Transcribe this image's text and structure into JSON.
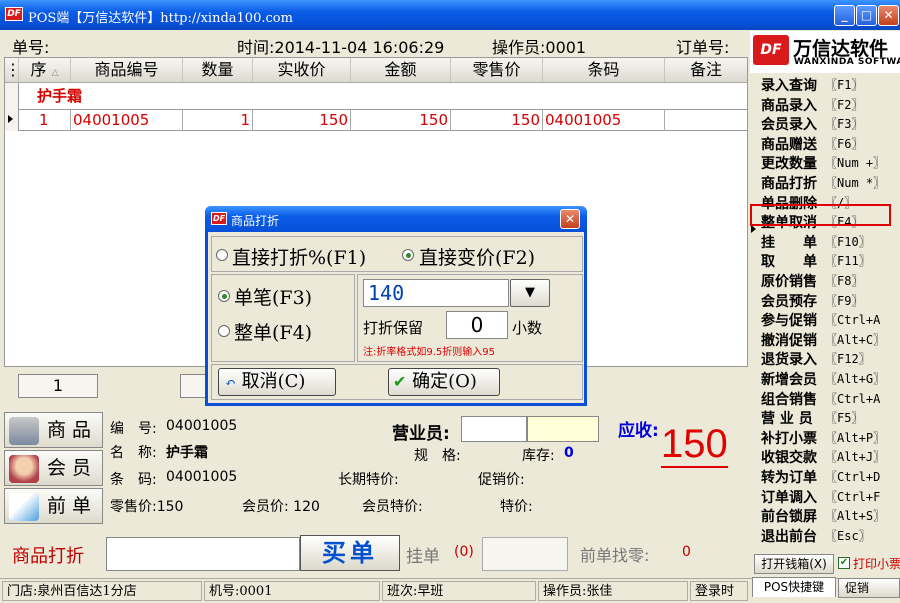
{
  "window": {
    "title": "POS端【万信达软件】http://xinda100.com",
    "min": "_",
    "max": "□",
    "close": "✕"
  },
  "info": {
    "order_no_label": "单号:",
    "time": "时间:2014-11-04 16:06:29",
    "operator": "操作员:0001",
    "order_label": "订单号:"
  },
  "grid": {
    "columns": [
      "序",
      "商品编号",
      "数量",
      "实收价",
      "金额",
      "零售价",
      "条码",
      "备注"
    ],
    "group_name": "护手霜",
    "rows": [
      {
        "seq": "1",
        "code": "04001005",
        "qty": "1",
        "paid": "150",
        "amount": "150",
        "retail": "150",
        "barcode": "04001005",
        "note": ""
      }
    ]
  },
  "pager": {
    "count": "1"
  },
  "nav": {
    "goods": "商品",
    "member": "会员",
    "prev": "前单"
  },
  "detail": {
    "code_label": "编　号:",
    "code": "04001005",
    "name_label": "名　称:",
    "name": "护手霜",
    "bar_label": "条　码:",
    "bar": "04001005",
    "retail": "零售价:150",
    "member_price": "会员价: 120",
    "member_special": "会员特价:",
    "special": "特价:",
    "long_special": "长期特价:",
    "promo": "促销价:",
    "spec": "规　格:",
    "stock_label": "库存:",
    "stock": "0",
    "salesman": "营业员:",
    "receivable": "应收:",
    "amount": "150"
  },
  "bottom": {
    "mode": "商品打折",
    "buy": "买单",
    "hang": "挂单",
    "hang_count": "(0)",
    "change": "前单找零:",
    "change_val": "0"
  },
  "status": {
    "store": "门店:泉州百信达1分店",
    "machine": "机号:0001",
    "shift": "班次:早班",
    "cashier": "操作员:张佳",
    "login": "登录时"
  },
  "brand": {
    "logo": "DF",
    "cn": "万信达软件",
    "en": "WANXINDA SOFTWARE"
  },
  "shortcuts": [
    {
      "name": "录入查询",
      "key": "〖F1〗"
    },
    {
      "name": "商品录入",
      "key": "〖F2〗"
    },
    {
      "name": "会员录入",
      "key": "〖F3〗"
    },
    {
      "name": "商品赠送",
      "key": "〖F6〗"
    },
    {
      "name": "更改数量",
      "key": "〖Num +〗"
    },
    {
      "name": "商品打折",
      "key": "〖Num *〗"
    },
    {
      "name": "单品删除",
      "key": "〖/〗"
    },
    {
      "name": "整单取消",
      "key": "〖F4〗"
    },
    {
      "name": "挂　　单",
      "key": "〖F10〗"
    },
    {
      "name": "取　　单",
      "key": "〖F11〗"
    },
    {
      "name": "原价销售",
      "key": "〖F8〗"
    },
    {
      "name": "会员预存",
      "key": "〖F9〗"
    },
    {
      "name": "参与促销",
      "key": "〖Ctrl+A"
    },
    {
      "name": "撤消促销",
      "key": "〖Alt+C〗"
    },
    {
      "name": "退货录入",
      "key": "〖F12〗"
    },
    {
      "name": "新增会员",
      "key": "〖Alt+G〗"
    },
    {
      "name": "组合销售",
      "key": "〖Ctrl+A"
    },
    {
      "name": "营 业 员",
      "key": "〖F5〗"
    },
    {
      "name": "补打小票",
      "key": "〖Alt+P〗"
    },
    {
      "name": "收银交款",
      "key": "〖Alt+J〗"
    },
    {
      "name": "转为订单",
      "key": "〖Ctrl+D"
    },
    {
      "name": "订单调入",
      "key": "〖Ctrl+F"
    },
    {
      "name": "前台锁屏",
      "key": "〖Alt+S〗"
    },
    {
      "name": "退出前台",
      "key": "〖Esc〗"
    }
  ],
  "right_buttons": {
    "drawer": "打开钱箱(X)",
    "print": "打印小票",
    "tab1": "POS快捷键",
    "tab2": "促销"
  },
  "dialog": {
    "title": "商品打折",
    "close": "✕",
    "opt_percent": "直接打折%(F1)",
    "opt_price": "直接变价(F2)",
    "opt_single": "单笔(F3)",
    "opt_whole": "整单(F4)",
    "value": "140",
    "keep_label": "打折保留",
    "keep_value": "0",
    "decimal": "小数",
    "hint": "注:折率格式如9.5折则输入95",
    "cancel": "取消(C)",
    "ok": "确定(O)"
  },
  "colors": {
    "title_blue": "#0a5ce6",
    "red": "#e10000",
    "blue_text": "#0000dd"
  }
}
